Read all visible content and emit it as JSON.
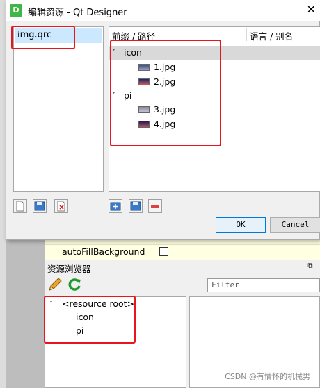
{
  "dialog": {
    "title": "编辑资源 - Qt Designer",
    "app_icon_letter": "D",
    "file_list": [
      "img.qrc"
    ],
    "tree_header": {
      "col1": "前缀 / 路径",
      "col2": "语言 / 别名"
    },
    "tree": [
      {
        "prefix": "icon",
        "files": [
          "1.jpg",
          "2.jpg"
        ]
      },
      {
        "prefix": "pi",
        "files": [
          "3.jpg",
          "4.jpg"
        ]
      }
    ],
    "ok_label": "OK",
    "cancel_label": "Cancel"
  },
  "property_editor": {
    "property_name": "autoFillBackground"
  },
  "resource_browser": {
    "title": "资源浏览器",
    "filter_placeholder": "Filter",
    "root_label": "<resource root>",
    "children": [
      "icon",
      "pi"
    ]
  },
  "watermark": "CSDN @有情怀的机械男",
  "colors": {
    "highlight": "#e8141e",
    "selection": "#cce8ff",
    "ok_border": "#0078d7",
    "property_bg": "#ffffe1"
  }
}
